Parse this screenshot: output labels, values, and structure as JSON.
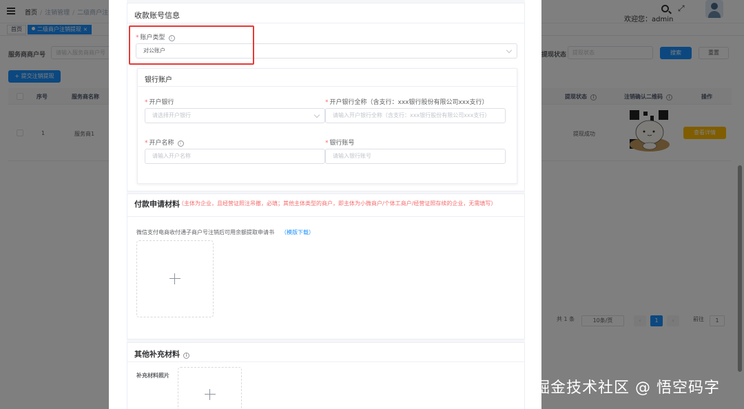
{
  "header": {
    "breadcrumbs": [
      "首页",
      "注销管理",
      "二级商户注"
    ],
    "welcome": "欢迎您：admin"
  },
  "tags": {
    "home": "首页",
    "active": "二级商户注销提现 ×"
  },
  "filters": {
    "merchant_no_label": "服务商商户号",
    "merchant_no_placeholder": "请输入服务商商户号",
    "status_label": "提现状态",
    "status_placeholder": "提现状态",
    "search_button": "搜索",
    "reset_button": "重置",
    "submit_button": "+ 提交注销提现"
  },
  "table": {
    "headers": [
      "序号",
      "服务商名称",
      "提现状态",
      "注销确认二维码",
      "操作"
    ],
    "rows": [
      {
        "index": "1",
        "name": "服务商1",
        "status": "提现成功",
        "action": "查看详情"
      }
    ]
  },
  "pagination": {
    "total": "共 1 条",
    "page_size": "10条/页",
    "current_page": "1",
    "goto_label": "前往",
    "goto_value": "1"
  },
  "drawer": {
    "receiving_section": {
      "title": "收款账号信息",
      "account_type_label": "账户类型",
      "account_type_value": "对公账户",
      "bank_section_title": "银行账户",
      "bank_label": "开户银行",
      "bank_placeholder": "请选择开户银行",
      "bank_fullname_label": "开户银行全称（含支行：xxx银行股份有限公司xxx支行）",
      "bank_fullname_placeholder": "请输入开户银行全称（含支行：xxx银行股份有限公司xxx支行）",
      "account_name_label": "开户名称",
      "account_name_placeholder": "请输入开户名称",
      "account_number_label": "银行账号",
      "account_number_placeholder": "请输入银行账号"
    },
    "payment_section": {
      "title": "付款申请材料",
      "note": "（主体为企业，且经营证照注吊撤，必填；其他主体类型的商户，即主体为小微商户/个体工商户/经营证照存续的企业，无需填写）",
      "doc_label": "微信支付电商收付通子商户号注销后可用余额提取申请书",
      "template_link": "（模版下载）"
    },
    "other_section": {
      "title": "其他补充材料",
      "photo_label": "补充材料照片"
    }
  },
  "watermark": "掘金技术社区 @ 悟空码字",
  "colors": {
    "primary": "#1890ff",
    "highlight": "#e53935",
    "required": "#f56c6c",
    "warning": "#ffba00"
  }
}
